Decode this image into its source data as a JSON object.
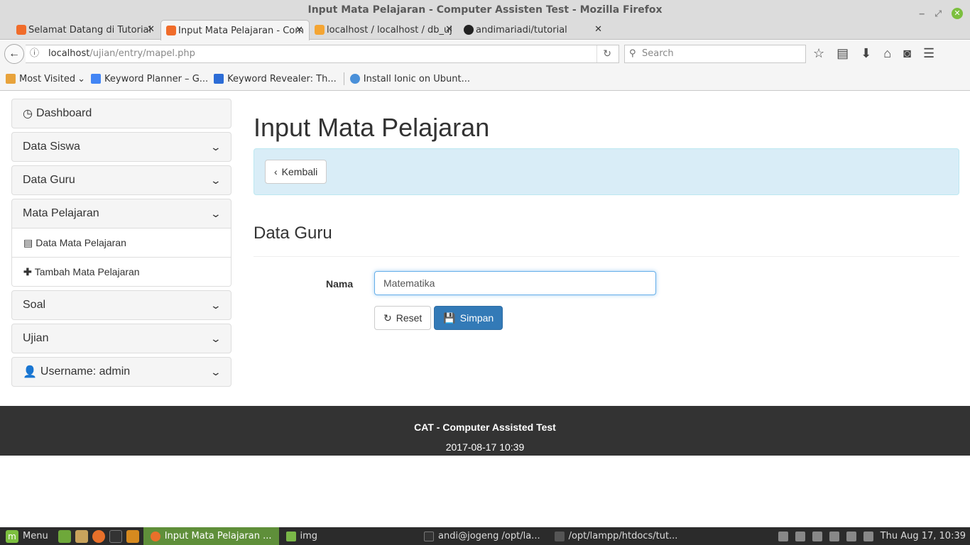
{
  "window": {
    "title": "Input Mata Pelajaran - Computer Assisten Test - Mozilla Firefox"
  },
  "tabs": [
    {
      "label": "Selamat Datang di Tutorial",
      "active": false
    },
    {
      "label": "Input Mata Pelajaran - Com",
      "active": true
    },
    {
      "label": "localhost / localhost / db_uji",
      "active": false
    },
    {
      "label": "andimariadi/tutorial",
      "active": false
    }
  ],
  "navbar": {
    "url_host": "localhost",
    "url_path": "/ujian/entry/mapel.php",
    "search_placeholder": "Search"
  },
  "bookmarks": [
    {
      "label": "Most Visited",
      "color": "#e8a33c"
    },
    {
      "label": "Keyword Planner – G...",
      "color": "#4285f4"
    },
    {
      "label": "Keyword Revealer: Th...",
      "color": "#2c6cd6"
    },
    {
      "label": "Install Ionic on Ubunt...",
      "color": "#4a90d9"
    }
  ],
  "sidebar": {
    "dashboard": "Dashboard",
    "data_siswa": "Data Siswa",
    "data_guru": "Data Guru",
    "mata_pelajaran": "Mata Pelajaran",
    "sub_data": "Data Mata Pelajaran",
    "sub_tambah": "Tambah Mata Pelajaran",
    "soal": "Soal",
    "ujian": "Ujian",
    "username": "Username: admin"
  },
  "main": {
    "title": "Input Mata Pelajaran",
    "back_label": "Kembali",
    "section_title": "Data Guru",
    "field_label": "Nama",
    "field_value": "Matematika",
    "reset_label": "Reset",
    "save_label": "Simpan"
  },
  "footer": {
    "app_name": "CAT - Computer Assisted Test",
    "datetime": "2017-08-17 10:39"
  },
  "taskbar": {
    "menu_label": "Menu",
    "tasks": [
      {
        "label": "Input Mata Pelajaran ...",
        "active": true
      },
      {
        "label": "img",
        "active": false
      },
      {
        "label": "andi@jogeng /opt/la...",
        "active": false
      },
      {
        "label": "/opt/lampp/htdocs/tut...",
        "active": false
      }
    ],
    "clock": "Thu Aug 17, 10:39"
  },
  "colors": {
    "primary": "#337ab7",
    "alert_bg": "#d9edf7",
    "footer_bg": "#333333",
    "taskbar_active": "#5f8f3a"
  }
}
